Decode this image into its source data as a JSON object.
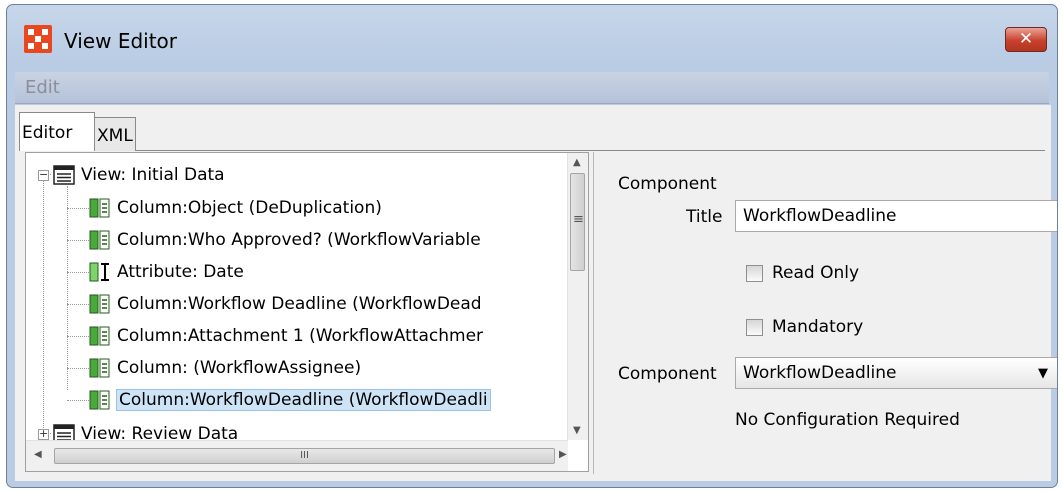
{
  "window": {
    "title": "View Editor",
    "close_glyph": "✕",
    "accent_color": "#e8471f"
  },
  "menu": {
    "edit_label": "Edit"
  },
  "tabs": [
    {
      "label": "Editor",
      "active": true
    },
    {
      "label": "XML",
      "active": false
    }
  ],
  "tree": {
    "items": [
      {
        "label": "View: Initial Data",
        "icon": "view-list-icon",
        "expanded": true,
        "level": 0
      },
      {
        "label": "Column:Object (DeDuplication)",
        "icon": "column-icon",
        "level": 1
      },
      {
        "label": "Column:Who Approved? (WorkflowVariable",
        "icon": "column-icon",
        "level": 1
      },
      {
        "label": "Attribute: Date",
        "icon": "attribute-icon",
        "level": 1
      },
      {
        "label": "Column:Workflow Deadline (WorkflowDead",
        "icon": "column-icon",
        "level": 1
      },
      {
        "label": "Column:Attachment 1 (WorkflowAttachmer",
        "icon": "column-icon",
        "level": 1
      },
      {
        "label": "Column: (WorkflowAssignee)",
        "icon": "column-icon",
        "level": 1
      },
      {
        "label": "Column:WorkflowDeadline (WorkflowDeadli",
        "icon": "column-icon",
        "level": 1,
        "selected": true
      },
      {
        "label": "View: Review Data",
        "icon": "view-list-icon",
        "expanded": false,
        "level": 0
      }
    ],
    "scrollbar_grip": "≡",
    "hscroll_grip": "III"
  },
  "properties": {
    "section_title": "Component",
    "title_label": "Title",
    "title_value": "WorkflowDeadline",
    "read_only_label": "Read Only",
    "read_only_checked": false,
    "mandatory_label": "Mandatory",
    "mandatory_checked": false,
    "component_label": "Component",
    "component_value": "WorkflowDeadline",
    "note": "No Configuration Required"
  }
}
